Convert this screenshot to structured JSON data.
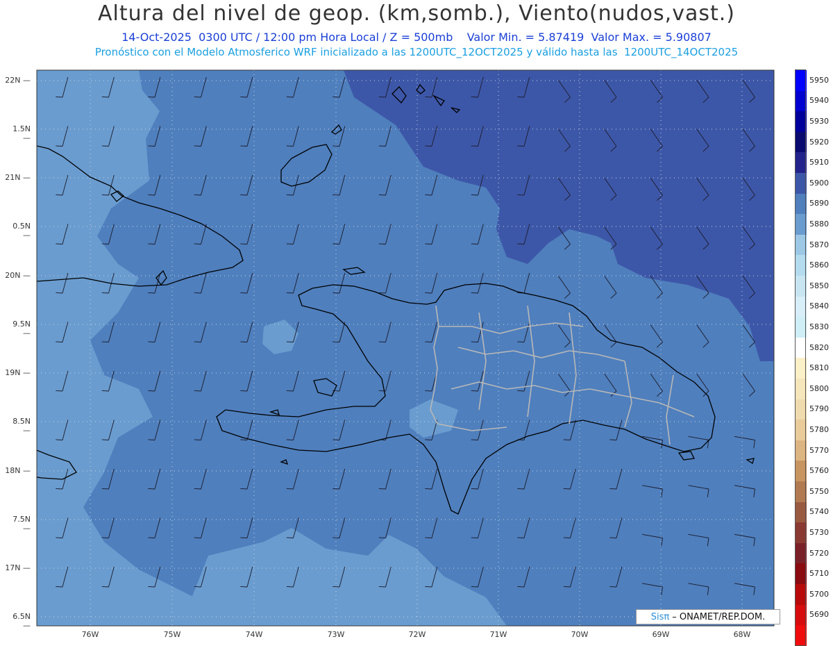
{
  "title": "Altura del nivel de geop. (km,somb.), Viento(nudos,vast.)",
  "subtitle1": "14-Oct-2025  0300 UTC / 12:00 pm Hora Local / Z = 500mb    Valor Min. = 5.87419  Valor Max. = 5.90807",
  "subtitle2": "Pronóstico con el Modelo Atmosferico WRF inicializado a las 1200UTC_12OCT2025 y válido hasta las  1200UTC_14OCT2025",
  "credit": {
    "brand": "Sisπ",
    "text": "– ONAMET/REP.DOM."
  },
  "axes": {
    "lat_labels": [
      "22N",
      "1.5N",
      "21N",
      "0.5N",
      "20N",
      "9.5N",
      "19N",
      "8.5N",
      "18N",
      "7.5N",
      "17N",
      "6.5N"
    ],
    "lon_labels": [
      "76W",
      "75W",
      "74W",
      "73W",
      "72W",
      "71W",
      "70W",
      "69W",
      "68W"
    ]
  },
  "colors": {
    "field_main": "#4f7fbd",
    "field_low": "#6a9ccf",
    "field_high": "#3d57a8",
    "coast": "#000000",
    "borders": "#b8b8b8",
    "grid": "#c8d4e8"
  },
  "colorbar": {
    "labels": [
      "5950",
      "5940",
      "5930",
      "5920",
      "5910",
      "5900",
      "5890",
      "5880",
      "5870",
      "5860",
      "5850",
      "5840",
      "5830",
      "5820",
      "5810",
      "5800",
      "5790",
      "5780",
      "5770",
      "5760",
      "5750",
      "5740",
      "5730",
      "5720",
      "5710",
      "5700",
      "5690"
    ],
    "colors": [
      "#0000ff",
      "#0000d0",
      "#00009a",
      "#0a0a70",
      "#23238c",
      "#3d57a8",
      "#4f7fbd",
      "#6a9ccf",
      "#9cc8e6",
      "#b4dcee",
      "#c8e6f2",
      "#d8eef8",
      "#cfeef6",
      "#ffffff",
      "#fbf0c8",
      "#f6e6bc",
      "#f0dbae",
      "#e9cc9a",
      "#ddb580",
      "#c89560",
      "#b27a50",
      "#9a5a40",
      "#8a3a32",
      "#7a2028",
      "#8a0b10",
      "#b80a0a",
      "#d80c0c",
      "#f00c0c"
    ]
  }
}
